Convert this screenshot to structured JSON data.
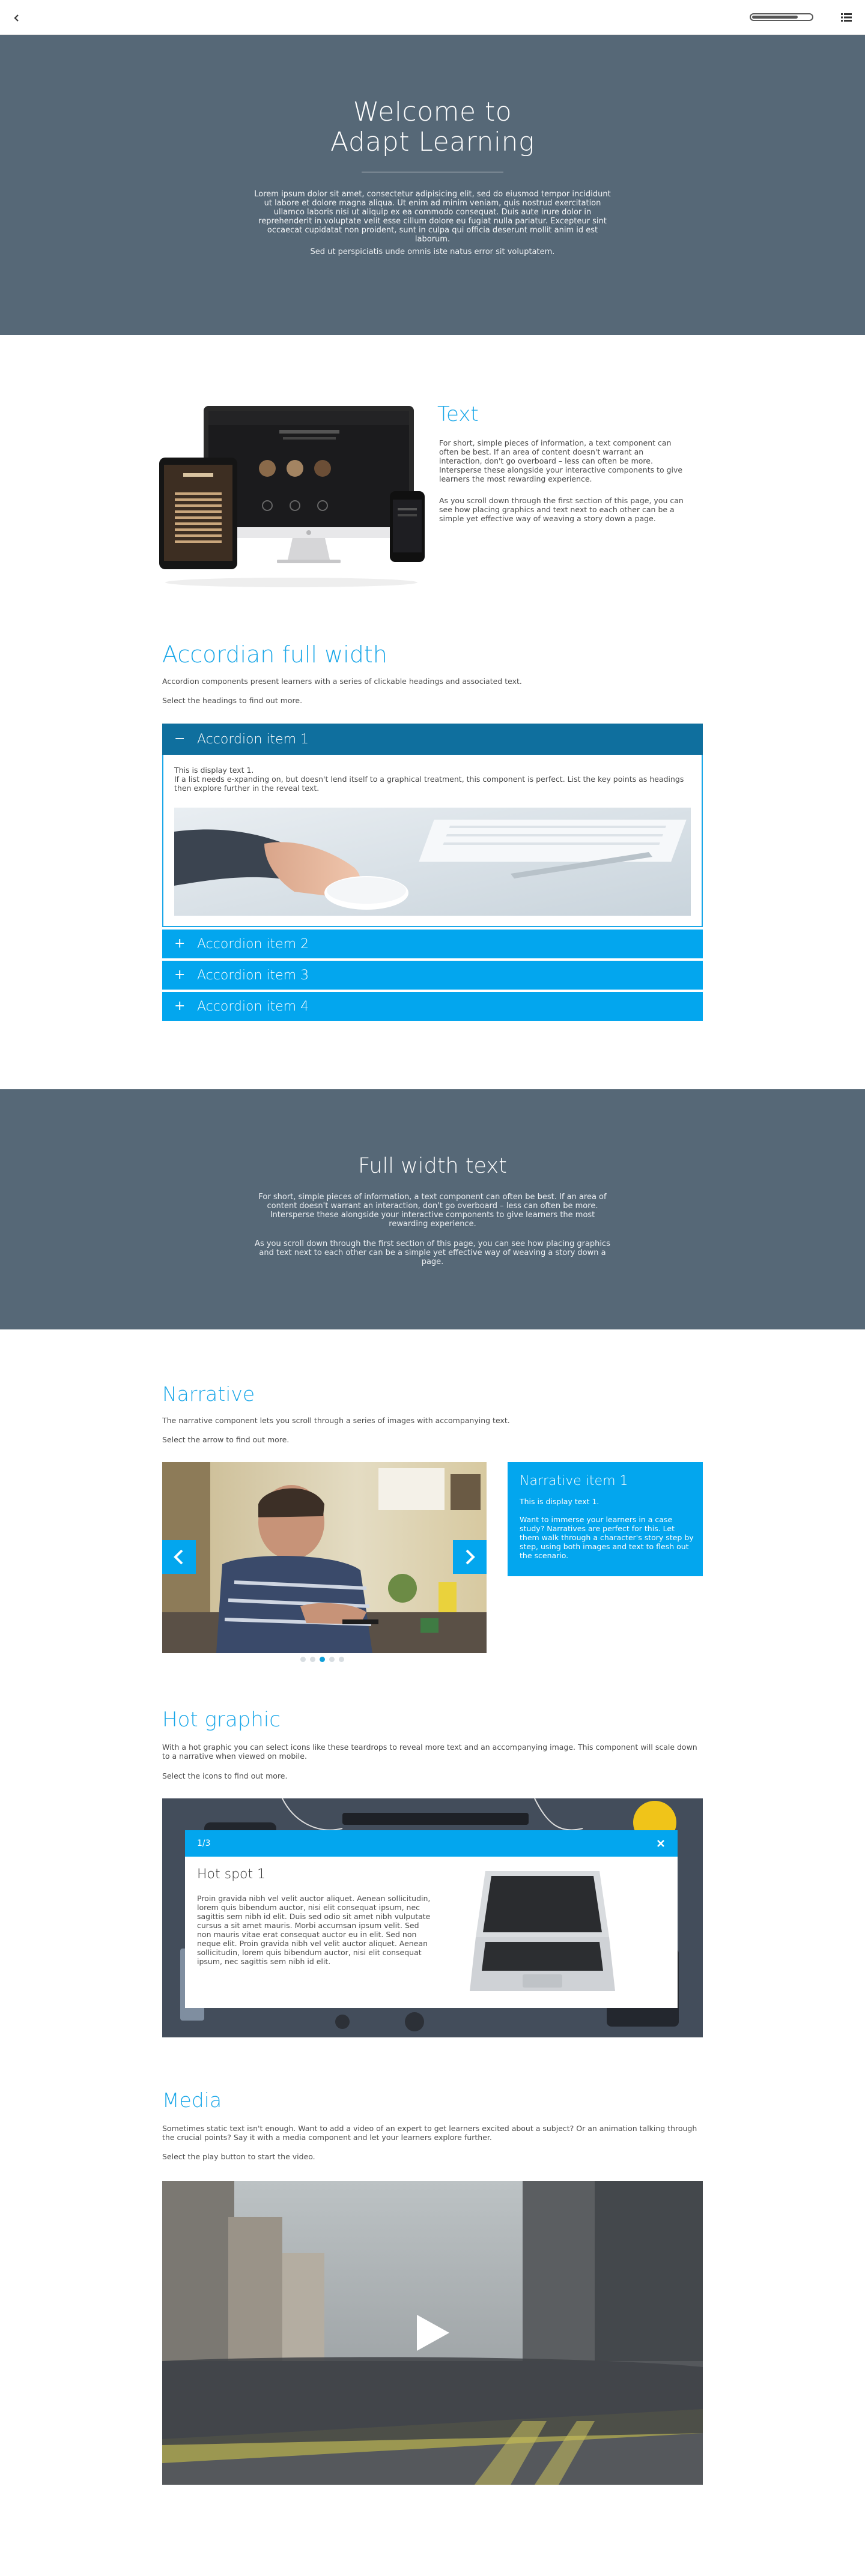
{
  "nav": {
    "back_icon": "back-arrow-icon",
    "progress_percent": 78,
    "menu_icon": "menu-list-icon"
  },
  "hero": {
    "title_line1": "Welcome to",
    "title_line2": "Adapt Learning",
    "body": "Lorem ipsum dolor sit amet, consectetur adipisicing elit, sed do eiusmod tempor incididunt ut labore et dolore magna aliqua. Ut enim ad minim veniam, quis nostrud exercitation ullamco laboris nisi ut aliquip ex ea commodo consequat. Duis aute irure dolor in reprehenderit in voluptate velit esse cillum dolore eu fugiat nulla pariatur. Excepteur sint occaecat cupidatat non proident, sunt in culpa qui officia deserunt mollit anim id est laborum.",
    "body2": "Sed ut perspiciatis unde omnis iste natus error sit voluptatem."
  },
  "text_block": {
    "title": "Text",
    "body1": "For short, simple pieces of information, a text component can often be best. If an area of content doesn't warrant an interaction, don't go overboard – less can often be more. Intersperse these alongside your interactive components to give learners the most rewarding experience.",
    "body2": "As you scroll down through the first section of this page, you can see how placing graphics and text next to each other can be a simple yet effective way of weaving a story down a page."
  },
  "accordion": {
    "title": "Accordian full width",
    "body": "Accordion components present learners with a series of clickable headings and associated text.",
    "instruction": "Select the headings to find out more.",
    "open_item": {
      "label": "Accordion item 1",
      "sign": "−",
      "text_line1": "This is display text 1.",
      "text_line2": "If a list needs e-xpanding on, but doesn't lend itself to a graphical treatment, this component is perfect. List the key points as headings then explore further in the reveal text."
    },
    "items": [
      {
        "label": "Accordion item 2",
        "sign": "+"
      },
      {
        "label": "Accordion item 3",
        "sign": "+"
      },
      {
        "label": "Accordion item 4",
        "sign": "+"
      }
    ]
  },
  "full_width": {
    "title": "Full width text",
    "body1": "For short, simple pieces of information, a text component can often be best. If an area of content doesn't warrant an interaction, don't go overboard – less can often be more. Intersperse these alongside your interactive components to give learners the most rewarding experience.",
    "body2": "As you scroll down through the first section of this page, you can see how placing graphics and text next to each other can be a simple yet effective way of weaving a story down a page."
  },
  "narrative": {
    "title": "Narrative",
    "body": "The narrative component lets you scroll through a series of images with accompanying text.",
    "instruction": "Select the arrow to find out more.",
    "card_title": "Narrative item 1",
    "card_text1": "This is display text 1.",
    "card_text2": "Want to immerse your learners in a case study? Narratives are perfect for this. Let them walk through a character's story step by step, using both images and text to flesh out the scenario.",
    "dots": 5,
    "active_dot": 2
  },
  "hot_graphic": {
    "title": "Hot graphic",
    "body": "With a hot graphic you can select icons like these teardrops to reveal more text and an accompanying image. This component will scale down to a narrative when viewed on mobile.",
    "instruction": "Select the icons to find out more.",
    "popup_count": "1/3",
    "popup_title": "Hot spot 1",
    "popup_text": "Proin gravida nibh vel velit auctor aliquet. Aenean sollicitudin, lorem quis bibendum auctor, nisi elit consequat ipsum, nec sagittis sem nibh id elit. Duis sed odio sit amet nibh vulputate cursus a sit amet mauris. Morbi accumsan ipsum velit. Sed non mauris vitae erat consequat auctor eu in elit. Sed non neque elit. Proin gravida nibh vel velit auctor aliquet. Aenean sollicitudin, lorem quis bibendum auctor, nisi elit consequat ipsum, nec sagittis sem nibh id elit."
  },
  "media": {
    "title": "Media",
    "body": "Sometimes static text isn't enough. Want to add a video of an expert to get learners excited about a subject? Or an animation talking through the crucial points? Say it with a media component and let your learners explore further.",
    "instruction": "Select the play button to start the video."
  },
  "colors": {
    "accent": "#03a6ee",
    "accent_dark": "#0f6f9e",
    "slate": "#566877"
  }
}
